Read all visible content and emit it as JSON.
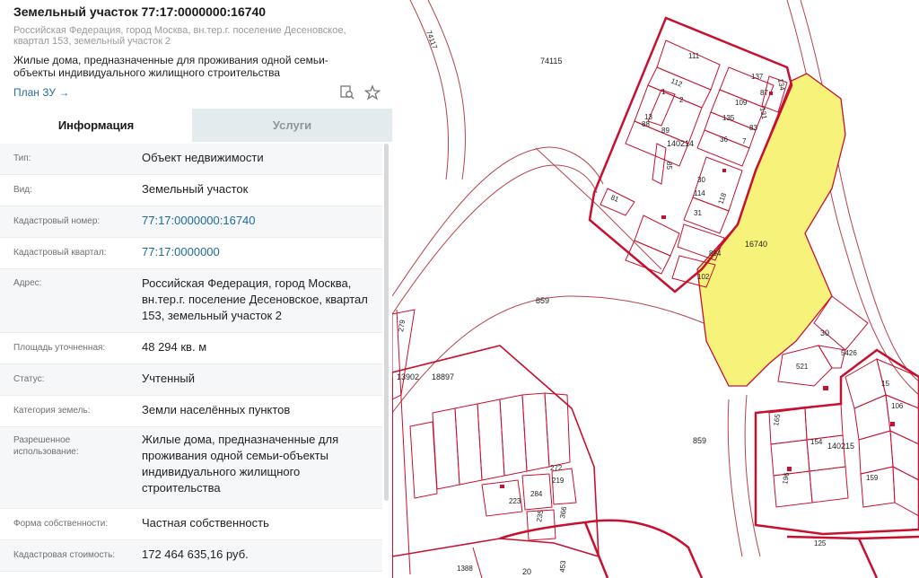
{
  "header": {
    "title": "Земельный участок 77:17:0000000:16740",
    "subaddress": "Российская Федерация, город Москва, вн.тер.г. поселение Десеновское, квартал 153, земельный участок 2",
    "usage": "Жилые дома, предназначенные для проживания одной семьи-объекты индивидуального жилищного строительства",
    "plan_link": "План ЗУ →"
  },
  "tabs": {
    "info": "Информация",
    "services": "Услуги"
  },
  "rows": [
    {
      "label": "Тип:",
      "value": "Объект недвижимости"
    },
    {
      "label": "Вид:",
      "value": "Земельный участок"
    },
    {
      "label": "Кадастровый номер:",
      "value": "77:17:0000000:16740"
    },
    {
      "label": "Кадастровый квартал:",
      "value": "77:17:0000000"
    },
    {
      "label": "Адрес:",
      "value": "Российская Федерация, город Москва, вн.тер.г. поселение Десеновское, квартал 153, земельный участок 2"
    },
    {
      "label": "Площадь уточненная:",
      "value": "48 294 кв. м"
    },
    {
      "label": "Статус:",
      "value": "Учтенный"
    },
    {
      "label": "Категория земель:",
      "value": "Земли населённых пунктов"
    },
    {
      "label": "Разрешенное использование:",
      "value": "Жилые дома, предназначенные для проживания одной семьи-объекты индивидуального жилищного строительства"
    },
    {
      "label": "Форма собственности:",
      "value": "Частная собственность"
    },
    {
      "label": "Кадастровая стоимость:",
      "value": "172 464 635,16 руб."
    }
  ],
  "map": {
    "highlight_color": "#f7f37a",
    "boundary_color": "#c8102e",
    "labels": {
      "parcel": "16740",
      "block_a": "140214",
      "block_b": "140215",
      "l74115": "74115",
      "l74117": "74117",
      "l859a": "859",
      "l859b": "859",
      "l30": "30",
      "l521": "521",
      "l5426": "5426",
      "l13902": "13902",
      "l18897": "18897",
      "l279": "279",
      "l20": "20",
      "l453": "453",
      "l1388": "1388",
      "l125": "125",
      "l111": "111",
      "l112": "112",
      "l137": "137",
      "l87": "87",
      "l134": "134",
      "l109": "109",
      "l131": "131",
      "l135": "135",
      "l83": "83",
      "l13": "13",
      "l88": "88",
      "l89": "89",
      "l7": "7",
      "l36": "36",
      "l30b": "30",
      "l114": "114",
      "l118": "118",
      "l31": "31",
      "l894": "894",
      "l102": "102",
      "l81": "81",
      "l85": "85",
      "l2": "2",
      "l1": "1",
      "l223": "223",
      "l284": "284",
      "l235": "235",
      "l272": "272",
      "l219": "219",
      "l366": "366",
      "l106": "106",
      "l159": "159",
      "l165": "165",
      "l154": "154",
      "l196": "196",
      "l15": "15"
    }
  }
}
